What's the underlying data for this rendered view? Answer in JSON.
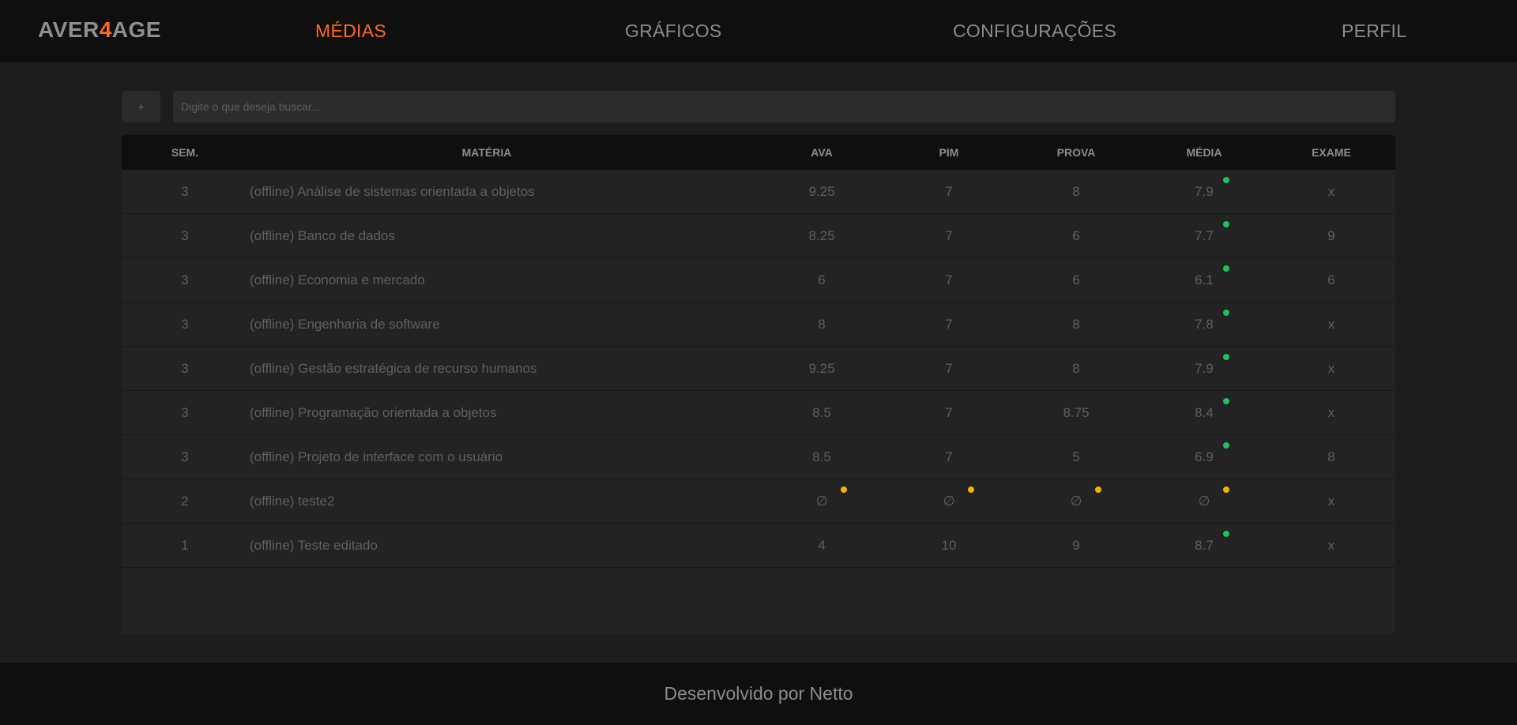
{
  "brand": {
    "prefix": "AVER",
    "accent": "4",
    "suffix": "AGE"
  },
  "nav": {
    "medias": "MÉDIAS",
    "graficos": "GRÁFICOS",
    "configuracoes": "CONFIGURAÇÕES",
    "perfil": "PERFIL"
  },
  "toolbar": {
    "add_label": "+",
    "search_placeholder": "Digite o que deseja buscar..."
  },
  "table": {
    "headers": {
      "sem": "SEM.",
      "materia": "MATÉRIA",
      "ava": "AVA",
      "pim": "PIM",
      "prova": "PROVA",
      "media": "MÉDIA",
      "exame": "EXAME"
    },
    "rows": [
      {
        "sem": "3",
        "materia": "(offline) Análise de sistemas orientada a objetos",
        "ava": "9.25",
        "pim": "7",
        "prova": "8",
        "media": "7.9",
        "exame": "x",
        "status": [
          "",
          "",
          "",
          "green"
        ]
      },
      {
        "sem": "3",
        "materia": "(offline) Banco de dados",
        "ava": "8.25",
        "pim": "7",
        "prova": "6",
        "media": "7.7",
        "exame": "9",
        "status": [
          "",
          "",
          "",
          "green"
        ]
      },
      {
        "sem": "3",
        "materia": "(offline) Economia e mercado",
        "ava": "6",
        "pim": "7",
        "prova": "6",
        "media": "6.1",
        "exame": "6",
        "status": [
          "",
          "",
          "",
          "green"
        ]
      },
      {
        "sem": "3",
        "materia": "(offline) Engenharia de software",
        "ava": "8",
        "pim": "7",
        "prova": "8",
        "media": "7.8",
        "exame": "x",
        "status": [
          "",
          "",
          "",
          "green"
        ]
      },
      {
        "sem": "3",
        "materia": "(offline) Gestão estratégica de recurso humanos",
        "ava": "9.25",
        "pim": "7",
        "prova": "8",
        "media": "7.9",
        "exame": "x",
        "status": [
          "",
          "",
          "",
          "green"
        ]
      },
      {
        "sem": "3",
        "materia": "(offline) Programação orientada a objetos",
        "ava": "8.5",
        "pim": "7",
        "prova": "8.75",
        "media": "8.4",
        "exame": "x",
        "status": [
          "",
          "",
          "",
          "green"
        ]
      },
      {
        "sem": "3",
        "materia": "(offline) Projeto de interface com o usuário",
        "ava": "8.5",
        "pim": "7",
        "prova": "5",
        "media": "6.9",
        "exame": "8",
        "status": [
          "",
          "",
          "",
          "green"
        ]
      },
      {
        "sem": "2",
        "materia": "(offline) teste2",
        "ava": "∅",
        "pim": "∅",
        "prova": "∅",
        "media": "∅",
        "exame": "x",
        "status": [
          "yellow",
          "yellow",
          "yellow",
          "yellow"
        ]
      },
      {
        "sem": "1",
        "materia": "(offline) Teste editado",
        "ava": "4",
        "pim": "10",
        "prova": "9",
        "media": "8.7",
        "exame": "x",
        "status": [
          "",
          "",
          "",
          "green"
        ]
      }
    ]
  },
  "footer": {
    "text": "Desenvolvido por Netto"
  },
  "colors": {
    "accent": "#ff6a1a",
    "status_ok": "#1fc25a",
    "status_pending": "#f5b400"
  }
}
